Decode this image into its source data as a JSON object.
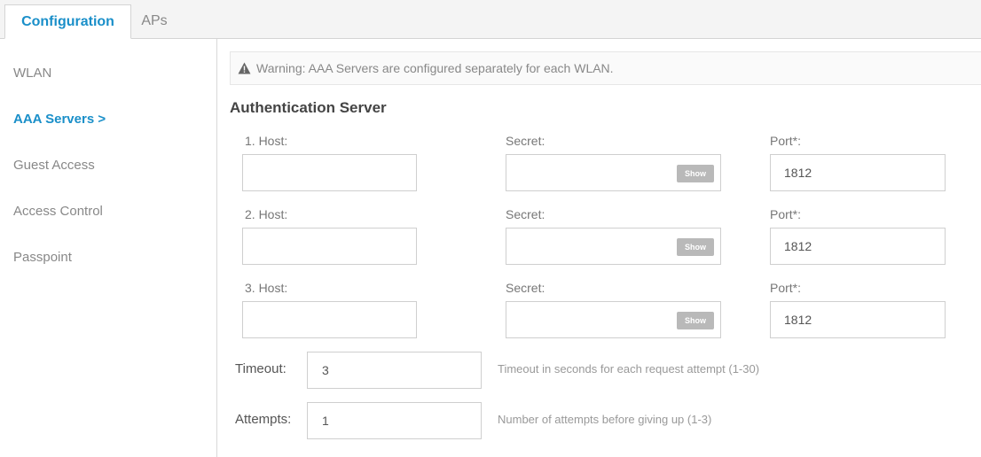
{
  "tabs": [
    {
      "label": "Configuration"
    },
    {
      "label": "APs"
    }
  ],
  "sidebar": {
    "items": [
      {
        "label": "WLAN"
      },
      {
        "label": "AAA Servers >"
      },
      {
        "label": "Guest Access"
      },
      {
        "label": "Access Control"
      },
      {
        "label": "Passpoint"
      }
    ]
  },
  "warning": {
    "text": "Warning:  AAA Servers are configured separately for each WLAN.",
    "icon": "warning-triangle-icon"
  },
  "section_title": "Authentication Server",
  "servers": [
    {
      "host_label": "1. Host:",
      "host_value": "",
      "secret_label": "Secret:",
      "secret_value": "",
      "show_label": "Show",
      "port_label": "Port*:",
      "port_value": "1812"
    },
    {
      "host_label": "2. Host:",
      "host_value": "",
      "secret_label": "Secret:",
      "secret_value": "",
      "show_label": "Show",
      "port_label": "Port*:",
      "port_value": "1812"
    },
    {
      "host_label": "3. Host:",
      "host_value": "",
      "secret_label": "Secret:",
      "secret_value": "",
      "show_label": "Show",
      "port_label": "Port*:",
      "port_value": "1812"
    }
  ],
  "timeout": {
    "label": "Timeout:",
    "value": "3",
    "hint": "Timeout in seconds for each request attempt (1-30)"
  },
  "attempts": {
    "label": "Attempts:",
    "value": "1",
    "hint": "Number of attempts before giving up (1-3)"
  },
  "colors": {
    "accent": "#1a8fc9",
    "show_button": "#b9b9b9"
  }
}
